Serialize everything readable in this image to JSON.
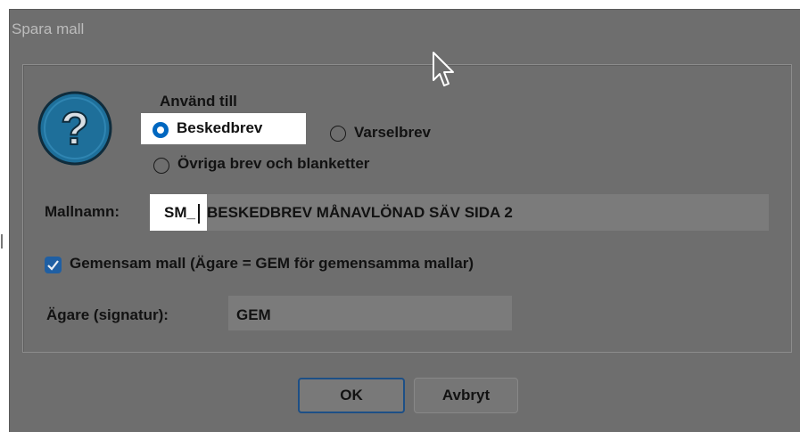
{
  "dialog": {
    "title": "Spara mall",
    "use_for_label": "Använd till",
    "radio_options": [
      {
        "label": "Beskedbrev",
        "selected": true
      },
      {
        "label": "Varselbrev",
        "selected": false
      },
      {
        "label": "Övriga brev och blanketter",
        "selected": false
      }
    ],
    "template_name_label": "Mallnamn:",
    "template_name_prefix": "SM_",
    "template_name_value": "BESKEDBREV MÅNAVLÖNAD SÄV SIDA 2",
    "shared_checkbox_label": "Gemensam mall (Ägare = GEM för gemensamma mallar)",
    "shared_checked": true,
    "owner_label": "Ägare (signatur):",
    "owner_value": "GEM",
    "ok_label": "OK",
    "cancel_label": "Avbryt"
  },
  "icons": {
    "help": "question-icon",
    "cursor": "mouse-pointer-icon",
    "check": "checkmark-icon"
  },
  "colors": {
    "accent": "#0067c0",
    "help_icon": "#1e6f9a",
    "dim_background": "#6e6e6e"
  }
}
